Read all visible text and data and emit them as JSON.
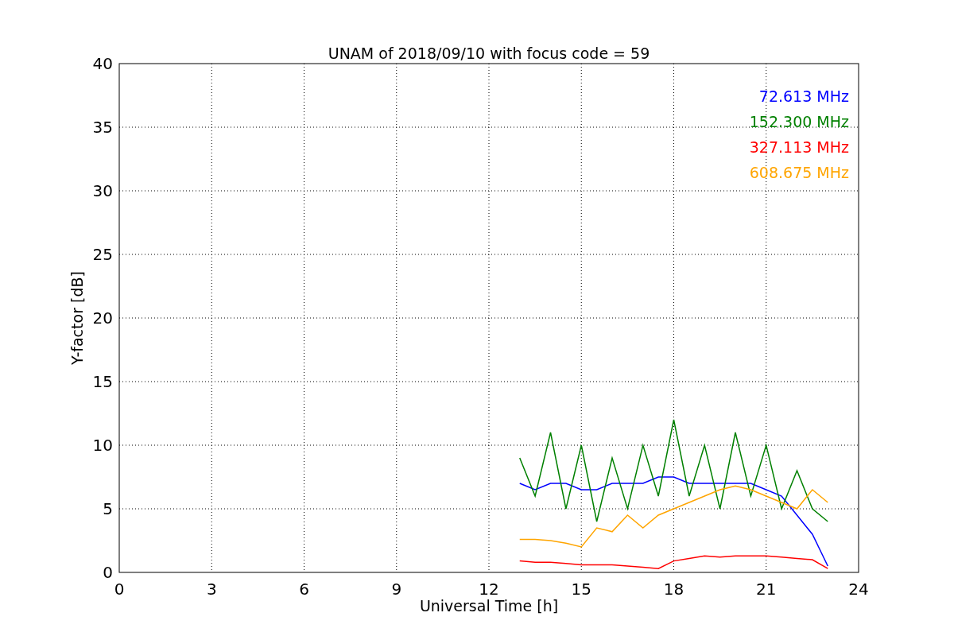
{
  "chart_data": {
    "type": "line",
    "title": "UNAM of 2018/09/10 with focus code = 59",
    "xlabel": "Universal Time [h]",
    "ylabel": "Y-factor [dB]",
    "x": [
      13,
      13.5,
      14,
      14.5,
      15,
      15.5,
      16,
      16.5,
      17,
      17.5,
      18,
      18.5,
      19,
      19.5,
      20,
      20.5,
      21,
      21.5,
      22,
      22.5,
      23
    ],
    "series": [
      {
        "name": "72.613 MHz",
        "color": "#0000ff",
        "values": [
          7,
          6.5,
          7,
          7,
          6.5,
          6.5,
          7,
          7,
          7,
          7.5,
          7.5,
          7,
          7,
          7,
          7,
          7,
          6.5,
          6,
          4.5,
          3,
          0.5
        ]
      },
      {
        "name": "152.300 MHz",
        "color": "#008000",
        "values": [
          9,
          6,
          11,
          5,
          10,
          4,
          9,
          5,
          10,
          6,
          12,
          6,
          10,
          5,
          11,
          6,
          10,
          5,
          8,
          5,
          4
        ]
      },
      {
        "name": "327.113 MHz",
        "color": "#ff0000",
        "values": [
          0.9,
          0.8,
          0.8,
          0.7,
          0.6,
          0.6,
          0.6,
          0.5,
          0.4,
          0.3,
          0.9,
          1.1,
          1.3,
          1.2,
          1.3,
          1.3,
          1.3,
          1.2,
          1.1,
          1.0,
          0.3
        ]
      },
      {
        "name": "608.675 MHz",
        "color": "#ffa500",
        "values": [
          2.6,
          2.6,
          2.5,
          2.3,
          2,
          3.5,
          3.2,
          4.5,
          3.5,
          4.5,
          5,
          5.5,
          6,
          6.5,
          6.8,
          6.5,
          6,
          5.5,
          5,
          6.5,
          5.5
        ]
      }
    ],
    "xlim": [
      0,
      24
    ],
    "ylim": [
      0,
      40
    ],
    "xticks": [
      0,
      3,
      6,
      9,
      12,
      15,
      18,
      21,
      24
    ],
    "yticks": [
      0,
      5,
      10,
      15,
      20,
      25,
      30,
      35,
      40
    ],
    "grid": true
  }
}
